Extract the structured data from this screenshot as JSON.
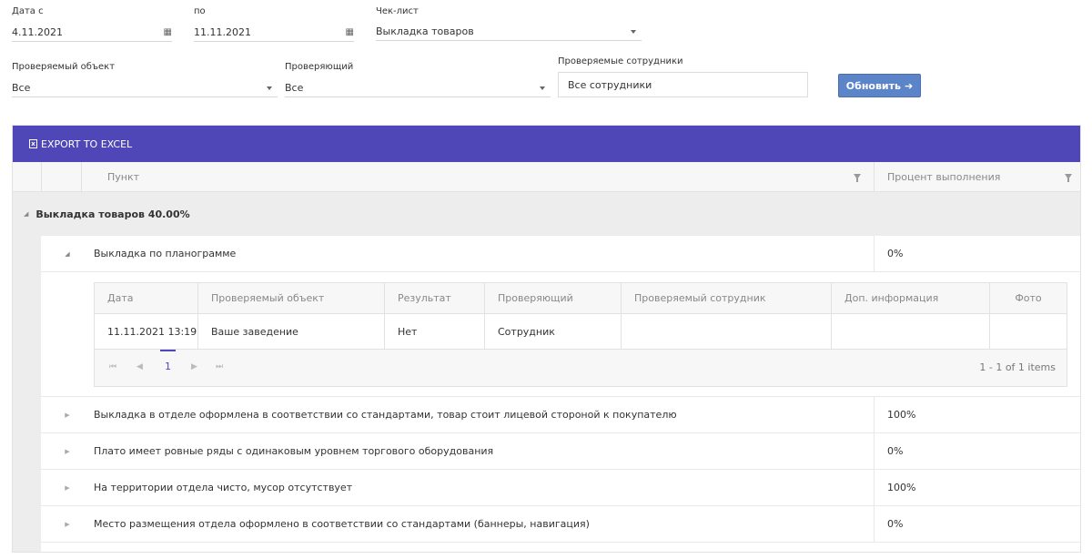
{
  "filters": {
    "date_from": {
      "label": "Дата с",
      "value": "4.11.2021"
    },
    "date_to": {
      "label": "по",
      "value": "11.11.2021"
    },
    "checklist": {
      "label": "Чек-лист",
      "value": "Выкладка товаров"
    },
    "object": {
      "label": "Проверяемый объект",
      "value": "Все"
    },
    "inspector": {
      "label": "Проверяющий",
      "value": "Все"
    },
    "employees": {
      "label": "Проверяемые сотрудники",
      "value": "Все сотрудники"
    },
    "refresh_label": "Обновить",
    "refresh_icon": "arrow-right-icon",
    "calendar_icon": "calendar-icon"
  },
  "grid": {
    "export_label": "EXPORT TO EXCEL",
    "col_item": "Пункт",
    "col_percent": "Процент выполнения",
    "group_label": "Выкладка товаров 40.00%",
    "rows": [
      {
        "label": "Выкладка по планограмме",
        "percent": "0%",
        "expanded": true
      },
      {
        "label": "Выкладка в отделе оформлена в соответствии со стандартами, товар стоит лицевой стороной к покупателю",
        "percent": "100%"
      },
      {
        "label": "Плато имеет ровные ряды с одинаковым уровнем торгового оборудования",
        "percent": "0%"
      },
      {
        "label": "На территории отдела чисто, мусор отсутствует",
        "percent": "100%"
      },
      {
        "label": "Место размещения отдела оформлено в соответствии со стандартами (баннеры, навигация)",
        "percent": "0%"
      }
    ],
    "detail": {
      "headers": [
        "Дата",
        "Проверяемый объект",
        "Результат",
        "Проверяющий",
        "Проверяемый сотрудник",
        "Доп. информация",
        "Фото"
      ],
      "row": [
        "11.11.2021 13:19",
        "Ваше заведение",
        "Нет",
        "Сотрудник",
        "",
        "",
        ""
      ],
      "pager": {
        "current_page": "1",
        "info": "1 - 1 of 1 items"
      }
    }
  },
  "colors": {
    "toolbar": "#4f47b8",
    "button": "#5b84c9",
    "group_bg": "#ededed"
  }
}
